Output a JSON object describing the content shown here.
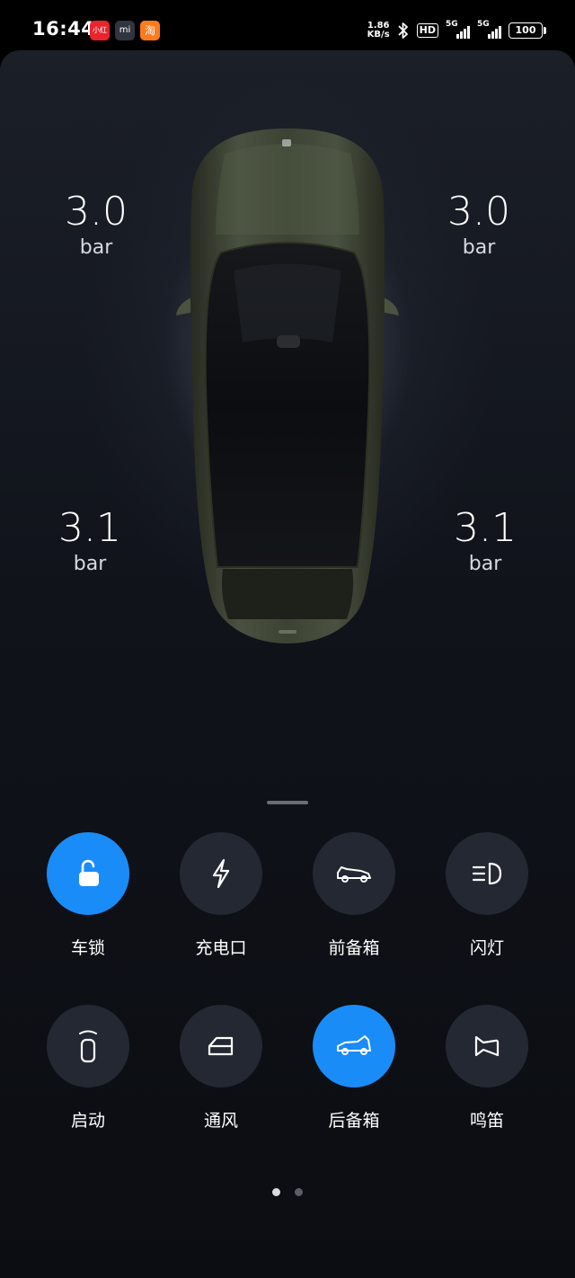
{
  "status_bar": {
    "time": "16:44",
    "apps": [
      "小红书",
      "mi",
      "淘"
    ],
    "net_speed_value": "1.86",
    "net_speed_unit": "KB/s",
    "hd_label": "HD",
    "sim1_label": "5G",
    "sim2_label": "5G",
    "battery": "100",
    "icons": [
      "bluetooth-icon",
      "signal-icon",
      "battery-icon"
    ]
  },
  "tire_pressure": {
    "front_left": {
      "value": "3.0",
      "unit": "bar"
    },
    "front_right": {
      "value": "3.0",
      "unit": "bar"
    },
    "rear_left": {
      "value": "3.1",
      "unit": "bar"
    },
    "rear_right": {
      "value": "3.1",
      "unit": "bar"
    }
  },
  "controls": [
    {
      "label": "车锁",
      "icon": "unlock-icon",
      "active": true
    },
    {
      "label": "充电口",
      "icon": "bolt-icon",
      "active": false
    },
    {
      "label": "前备箱",
      "icon": "front-trunk-icon",
      "active": false
    },
    {
      "label": "闪灯",
      "icon": "headlight-icon",
      "active": false
    },
    {
      "label": "启动",
      "icon": "key-fob-icon",
      "active": false
    },
    {
      "label": "通风",
      "icon": "window-icon",
      "active": false
    },
    {
      "label": "后备箱",
      "icon": "rear-trunk-icon",
      "active": true
    },
    {
      "label": "鸣笛",
      "icon": "horn-icon",
      "active": false
    }
  ],
  "pager": {
    "pages": 2,
    "current": 1
  },
  "colors": {
    "accent": "#1a8cf8",
    "button_bg": "#232833",
    "car_body": "#3c4230"
  }
}
